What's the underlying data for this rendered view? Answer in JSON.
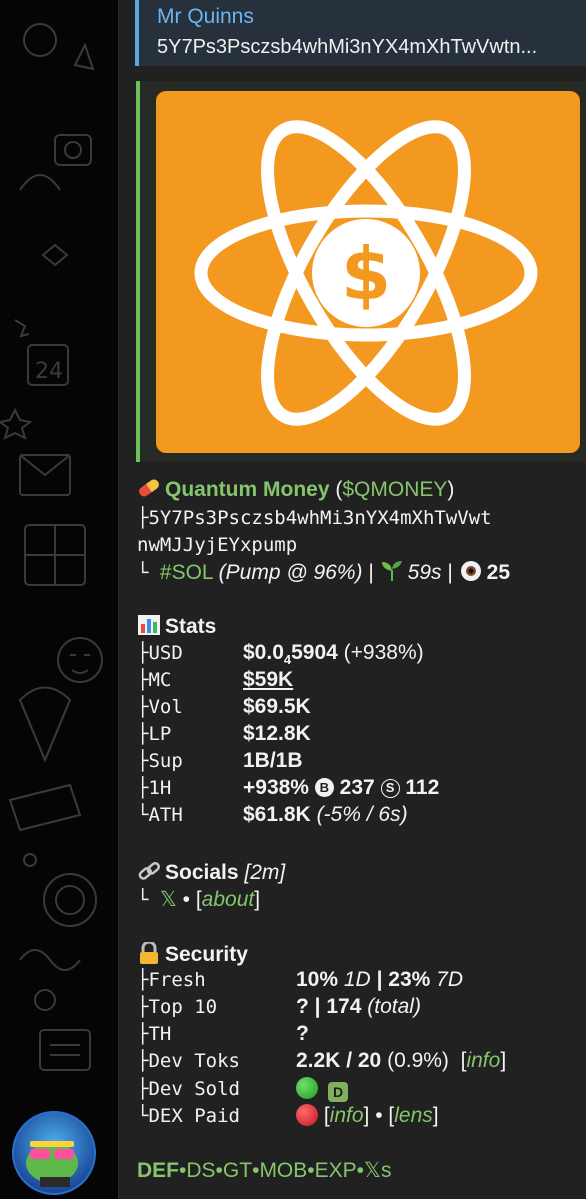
{
  "reply": {
    "sender": "Mr Quinns",
    "text": "5Y7Ps3Psczsb4whMi3nYX4mXhTwVwtn..."
  },
  "token": {
    "name": "Quantum Money",
    "ticker": "$QMONEY",
    "address_line1": "5Y7Ps3Psczsb4whMi3nYX4mXhTwVwt",
    "address_line2": "nwMJJyjEYxpump",
    "chain": "#SOL",
    "pump": "(Pump @ 96%)",
    "age": "59s",
    "views": "25"
  },
  "stats": {
    "heading": "Stats",
    "rows": [
      {
        "label": "USD",
        "value": "$0.0",
        "sub": "4",
        "value2": "5904",
        "extra": " (+938%)"
      },
      {
        "label": "MC",
        "value": "$59K"
      },
      {
        "label": "Vol",
        "value": "$69.5K"
      },
      {
        "label": "LP",
        "value": "$12.8K"
      },
      {
        "label": "Sup",
        "value": "1B/1B"
      },
      {
        "label": "1H",
        "value": "+938%",
        "buys_icon": "B",
        "buys": "237",
        "sells_icon": "S",
        "sells": "112"
      },
      {
        "label": "ATH",
        "value": "$61.8K",
        "extra": "(-5% / 6s)"
      }
    ]
  },
  "socials": {
    "heading": "Socials",
    "age": "[2m]",
    "x_label": "𝕏",
    "about": "about"
  },
  "security": {
    "heading": "Security",
    "rows": [
      {
        "label": "Fresh",
        "v1": "10%",
        "v1b": "1D",
        "v2": "23%",
        "v2b": "7D"
      },
      {
        "label": "Top 10",
        "v1": "?",
        "v2": "174",
        "v2b": "(total)"
      },
      {
        "label": "TH",
        "v1": "?"
      },
      {
        "label": "Dev Toks",
        "v1": "2.2K / 20",
        "v1b": "(0.9%)",
        "link": "info"
      },
      {
        "label": "Dev Sold",
        "status": "green",
        "badge": "D"
      },
      {
        "label": "DEX Paid",
        "status": "red",
        "link": "info",
        "link2": "lens"
      }
    ]
  },
  "footer": {
    "links": [
      "DEF",
      "DS",
      "GT",
      "MOB",
      "EXP",
      "𝕏s"
    ]
  },
  "colors": {
    "accent_green": "#85c56c",
    "reply_blue": "#6cb5ef",
    "thumb_orange": "#f4991f"
  },
  "icons": [
    "pill-icon",
    "seedling-icon",
    "eye-icon",
    "chart-icon",
    "link-icon",
    "lock-icon",
    "atom-dollar-logo"
  ]
}
